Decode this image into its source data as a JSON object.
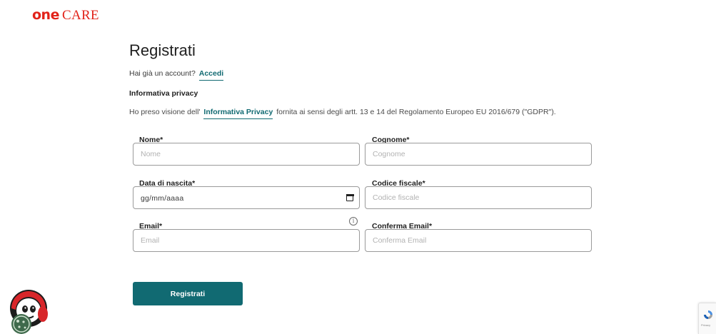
{
  "brand": {
    "one": "one",
    "care": "CARE"
  },
  "page": {
    "title": "Registrati"
  },
  "account": {
    "prompt": "Hai già un account?",
    "link": "Accedi"
  },
  "privacy": {
    "heading": "Informativa privacy",
    "text_before": "Ho preso visione dell'",
    "link": "Informativa Privacy",
    "text_after": "fornita ai sensi degli artt. 13 e 14 del Regolamento Europeo EU 2016/679 (\"GDPR\")."
  },
  "form": {
    "nome": {
      "label": "Nome*",
      "placeholder": "Nome"
    },
    "cognome": {
      "label": "Cognome*",
      "placeholder": "Cognome"
    },
    "data_nascita": {
      "label": "Data di nascita*",
      "placeholder": "gg/mm/aaaa"
    },
    "codice_fiscale": {
      "label": "Codice fiscale*",
      "placeholder": "Codice fiscale"
    },
    "email": {
      "label": "Email*",
      "placeholder": "Email"
    },
    "conferma_email": {
      "label": "Conferma Email*",
      "placeholder": "Conferma Email"
    },
    "submit_label": "Registrati"
  },
  "icons": {
    "info": "info-icon",
    "calendar": "calendar-icon",
    "cookie": "cookie-icon"
  },
  "recaptcha": {
    "text": "Privacy"
  },
  "colors": {
    "brand_red": "#e2231a",
    "accent_teal": "#116a72"
  }
}
